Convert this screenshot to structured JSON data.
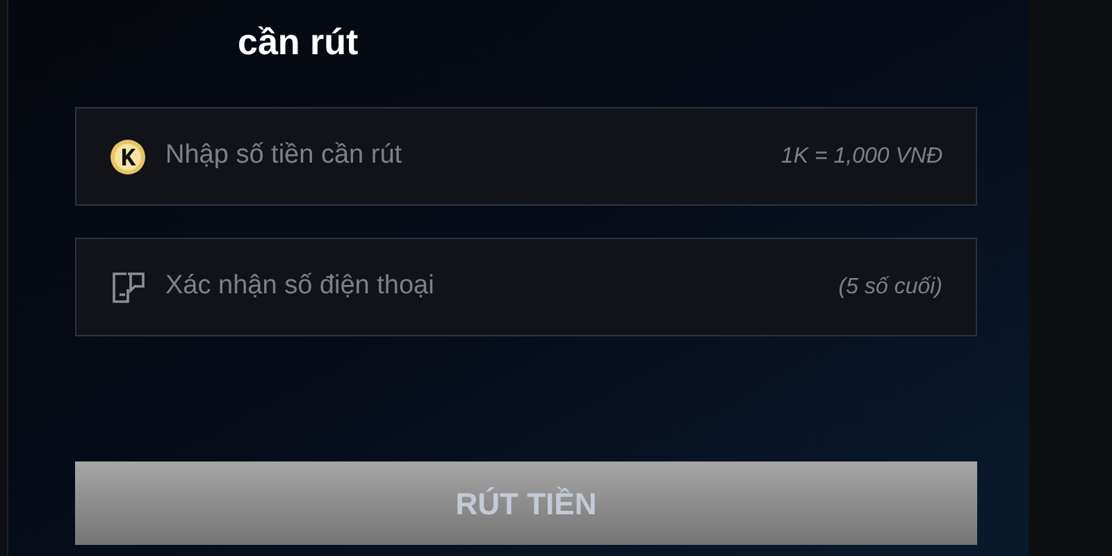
{
  "title": "cần rút",
  "fields": [
    {
      "kind": "coin",
      "placeholder": "Nhập số tiền cần rút",
      "hint": "1K = 1,000 VNĐ"
    },
    {
      "kind": "phone",
      "placeholder": "Xác nhận số điện thoại",
      "hint": "(5 số cuối)"
    }
  ],
  "submit": {
    "label": "RÚT TIỀN",
    "disabled": true
  }
}
